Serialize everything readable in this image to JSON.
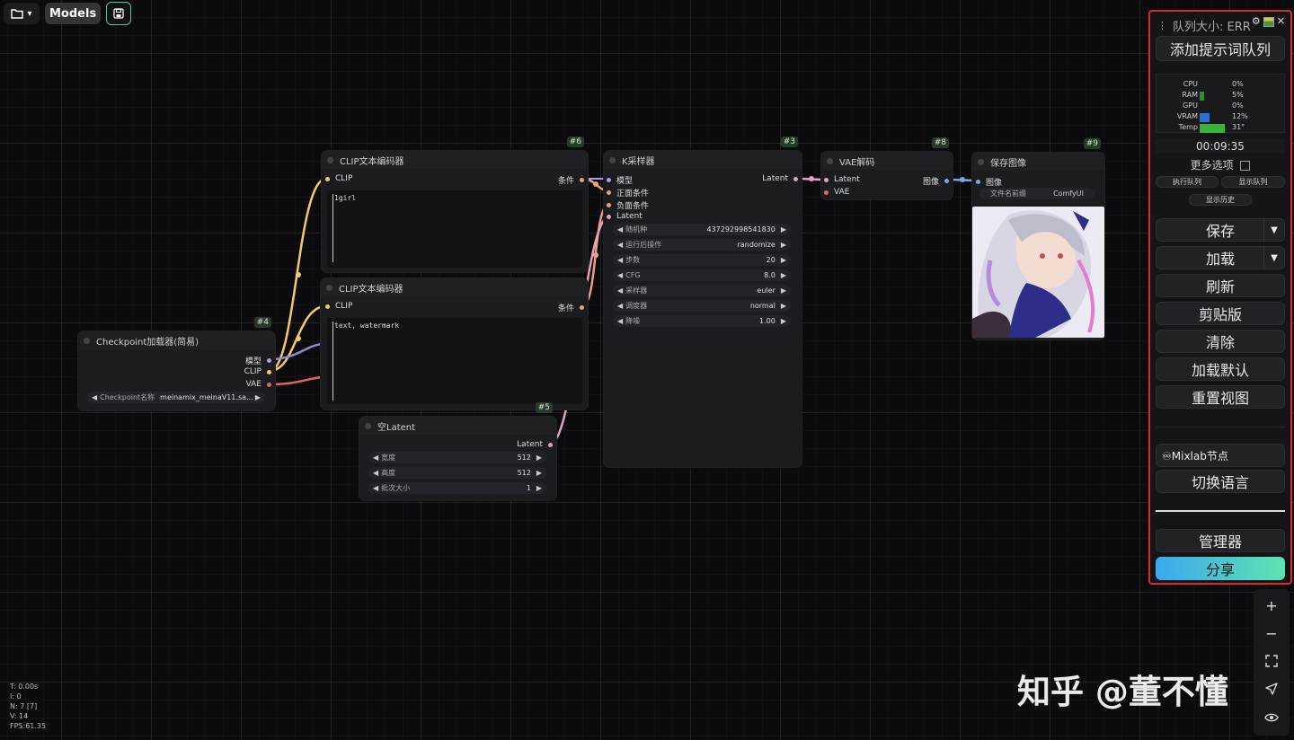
{
  "topbar": {
    "folder_icon": "folder-icon",
    "caret": "▾",
    "models_label": "Models",
    "save_icon": "save-icon"
  },
  "nodes": {
    "clip1": {
      "id": "#6",
      "title": "CLIP文本编码器",
      "input": "CLIP",
      "output": "条件",
      "text": "1girl"
    },
    "clip2": {
      "title": "CLIP文本编码器",
      "input": "CLIP",
      "output": "条件",
      "text": "text, watermark"
    },
    "ksampler": {
      "id": "#3",
      "title": "K采样器",
      "inputs": [
        "模型",
        "正面条件",
        "负面条件",
        "Latent"
      ],
      "output": "Latent",
      "widgets": [
        {
          "label": "随机种",
          "value": "437292998541830"
        },
        {
          "label": "运行后操作",
          "value": "randomize"
        },
        {
          "label": "步数",
          "value": "20"
        },
        {
          "label": "CFG",
          "value": "8.0"
        },
        {
          "label": "采样器",
          "value": "euler"
        },
        {
          "label": "调度器",
          "value": "normal"
        },
        {
          "label": "降噪",
          "value": "1.00"
        }
      ]
    },
    "vae": {
      "id": "#8",
      "title": "VAE解码",
      "inputs": [
        "Latent",
        "VAE"
      ],
      "output": "图像"
    },
    "save": {
      "id": "#9",
      "title": "保存图像",
      "input": "图像",
      "widget_label": "文件名前缀",
      "widget_value": "ComfyUI"
    },
    "checkpoint": {
      "id": "#4",
      "title": "Checkpoint加载器(简易)",
      "outputs": [
        "模型",
        "CLIP",
        "VAE"
      ],
      "widget_label": "Checkpoint名称",
      "widget_value": "meinamix_meinaV11.sa..."
    },
    "latent": {
      "id": "#5",
      "title": "空Latent",
      "output": "Latent",
      "widgets": [
        {
          "label": "宽度",
          "value": "512"
        },
        {
          "label": "高度",
          "value": "512"
        },
        {
          "label": "批次大小",
          "value": "1"
        }
      ]
    }
  },
  "panel": {
    "title": "队列大小: ERR",
    "queue_button": "添加提示词队列",
    "stats": [
      {
        "name": "CPU",
        "value": "0%",
        "percent": 0,
        "color": "#2e8b2e"
      },
      {
        "name": "RAM",
        "value": "5%",
        "percent": 5,
        "color": "#2e8b2e"
      },
      {
        "name": "GPU",
        "value": "0%",
        "percent": 0,
        "color": "#2e8b2e"
      },
      {
        "name": "VRAM",
        "value": "12%",
        "percent": 12,
        "color": "#2a6fd6"
      },
      {
        "name": "Temp",
        "value": "31°",
        "percent": 31,
        "color": "#3bb33b"
      }
    ],
    "timer": "00:09:35",
    "more_options": "更多选项",
    "exec_queue": "执行队列",
    "show_queue": "显示队列",
    "show_history": "显示历史",
    "save": "保存",
    "load": "加载",
    "refresh": "刷新",
    "clipspace": "剪贴版",
    "clear": "清除",
    "load_default": "加载默认",
    "reset_view": "重置视图",
    "mixlab": "♾Mixlab节点",
    "switch_lang": "切换语言",
    "manager": "管理器",
    "share": "分享"
  },
  "info": {
    "t": "T: 0.00s",
    "i": "I: 0",
    "n": "N: 7 [7]",
    "v": "V: 14",
    "fps": "FPS:61.35"
  },
  "watermark": "知乎 @董不懂",
  "colors": {
    "accent_red": "#d42d2d",
    "clip_wire": "#f5c969",
    "cond_wire": "#e8a27c",
    "latent_wire": "#e6a0c4",
    "vae_wire": "#e06666",
    "model_wire": "#b39ddb",
    "image_wire": "#7fa8d6",
    "share_start": "#3aa8f0",
    "share_end": "#5fe3b0"
  }
}
